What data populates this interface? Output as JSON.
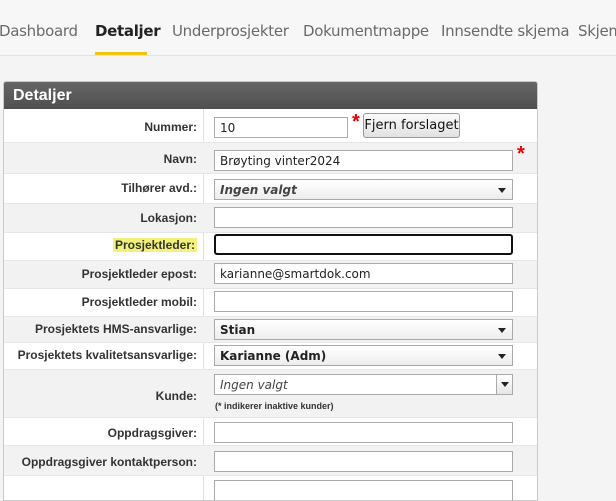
{
  "tabs": [
    {
      "label": "Dashboard"
    },
    {
      "label": "Detaljer"
    },
    {
      "label": "Underprosjekter"
    },
    {
      "label": "Dokumentmappe"
    },
    {
      "label": "Innsendte skjema"
    },
    {
      "label": "Skjem"
    }
  ],
  "active_tab": "Detaljer",
  "accent_color": "#f1c40f",
  "panel": {
    "title": "Detaljer",
    "fields": {
      "nummer": {
        "label": "Nummer:",
        "value": "10",
        "button": "Fjern forslaget",
        "required": "*"
      },
      "navn": {
        "label": "Navn:",
        "value": "Brøyting vinter2024",
        "required": "*"
      },
      "avdeling": {
        "label": "Tilhører avd.:",
        "value": "Ingen valgt"
      },
      "lokasjon": {
        "label": "Lokasjon:",
        "value": ""
      },
      "prosjektleder": {
        "label": "Prosjektleder:",
        "value": ""
      },
      "prosjektleder_epost": {
        "label": "Prosjektleder epost:",
        "value": "karianne@smartdok.com"
      },
      "prosjektleder_mobil": {
        "label": "Prosjektleder mobil:",
        "value": ""
      },
      "hms": {
        "label": "Prosjektets HMS-ansvarlige:",
        "value": "Stian"
      },
      "kvalitet": {
        "label": "Prosjektets kvalitetsansvarlige:",
        "value": "Karianne (Adm)"
      },
      "kunde": {
        "label": "Kunde:",
        "value": "Ingen valgt",
        "hint": "(* indikerer inaktive kunder)"
      },
      "oppdragsgiver": {
        "label": "Oppdragsgiver:",
        "value": ""
      },
      "oppdragsgiver_kontakt": {
        "label": "Oppdragsgiver kontaktperson:",
        "value": ""
      }
    }
  }
}
